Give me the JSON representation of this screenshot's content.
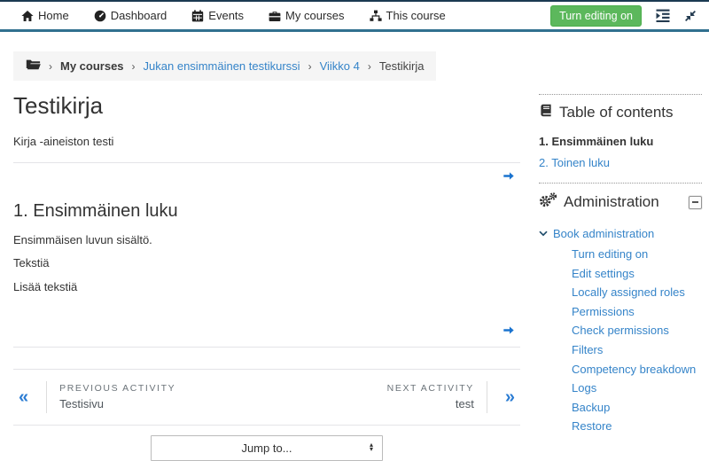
{
  "topnav": {
    "items": [
      {
        "label": "Home"
      },
      {
        "label": "Dashboard"
      },
      {
        "label": "Events"
      },
      {
        "label": "My courses"
      },
      {
        "label": "This course"
      }
    ],
    "turn_editing_on_label": "Turn editing on"
  },
  "breadcrumb": {
    "separator": "›",
    "my_courses": "My courses",
    "course": "Jukan ensimmäinen testikurssi",
    "section": "Viikko 4",
    "current": "Testikirja"
  },
  "main": {
    "title": "Testikirja",
    "description": "Kirja -aineiston testi",
    "chapter": {
      "title": "1. Ensimmäinen luku",
      "paragraphs": [
        "Ensimmäisen luvun sisältö.",
        "Tekstiä",
        "Lisää tekstiä"
      ]
    },
    "prev_next": {
      "previous_label": "PREVIOUS ACTIVITY",
      "previous_title": "Testisivu",
      "next_label": "NEXT ACTIVITY",
      "next_title": "test"
    },
    "jump_to_label": "Jump to..."
  },
  "sidebar": {
    "toc": {
      "title": "Table of contents",
      "items": [
        {
          "label": "1. Ensimmäinen luku",
          "current": true
        },
        {
          "label": "2. Toinen luku",
          "current": false
        }
      ]
    },
    "administration": {
      "title": "Administration",
      "root_label": "Book administration",
      "items": [
        "Turn editing on",
        "Edit settings",
        "Locally assigned roles",
        "Permissions",
        "Check permissions",
        "Filters",
        "Competency breakdown",
        "Logs",
        "Backup",
        "Restore"
      ]
    }
  },
  "colors": {
    "accent_green": "#5cb85c",
    "link_blue": "#3584c9",
    "arrow_blue": "#1a73cf",
    "navbar_line": "#31708f",
    "navbar_top_border": "#1b3a52"
  }
}
